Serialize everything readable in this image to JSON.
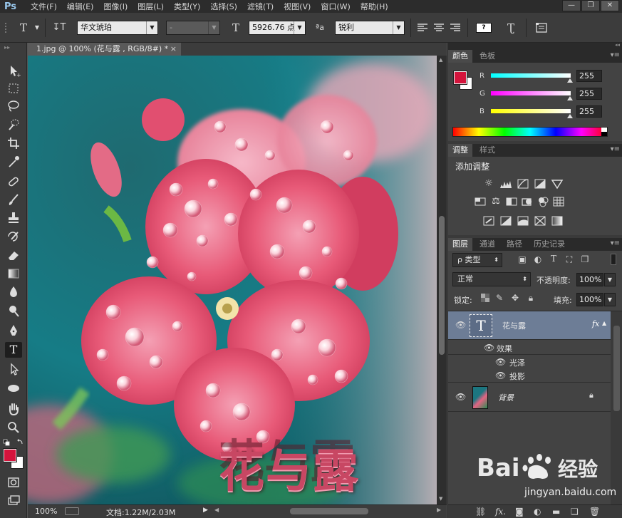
{
  "app": {
    "logo": "Ps",
    "menu": [
      "文件(F)",
      "编辑(E)",
      "图像(I)",
      "图层(L)",
      "类型(Y)",
      "选择(S)",
      "滤镜(T)",
      "视图(V)",
      "窗口(W)",
      "帮助(H)"
    ],
    "window_buttons": [
      "—",
      "❐",
      "✕"
    ]
  },
  "options_bar": {
    "font_family": "华文琥珀",
    "font_style": "-",
    "font_size": "5926.76 点",
    "aa_label": "ªa",
    "anti_alias": "锐利",
    "text_icon": "T",
    "orient_icon": "↧T",
    "size_icon": "T"
  },
  "document": {
    "tab_title": "1.jpg @ 100% (花与露 , RGB/8#) *",
    "close": "×",
    "overlay_text": "花与露"
  },
  "status": {
    "zoom": "100%",
    "doc_info": "文档:1.22M/2.03M"
  },
  "color_panel": {
    "tabs": [
      "颜色",
      "色板"
    ],
    "channels": [
      {
        "label": "R",
        "value": "255",
        "color": "#00ffff"
      },
      {
        "label": "G",
        "value": "255",
        "color": "#ff00ff"
      },
      {
        "label": "B",
        "value": "255",
        "color": "#ffff00"
      }
    ],
    "foreground": "#d4143c",
    "background": "#ffffff"
  },
  "adjust_panel": {
    "tabs": [
      "调整",
      "样式"
    ],
    "title": "添加调整"
  },
  "layers_panel": {
    "tabs": [
      "图层",
      "通道",
      "路径",
      "历史记录"
    ],
    "filter_kind": "ρ 类型",
    "blend_mode": "正常",
    "opacity_label": "不透明度:",
    "opacity": "100%",
    "lock_label": "锁定:",
    "fill_label": "填充:",
    "fill": "100%",
    "layers": [
      {
        "name": "花与露",
        "type": "text",
        "thumb": "T",
        "fx": "fx"
      },
      {
        "name": "背景",
        "type": "image"
      }
    ],
    "effects_label": "效果",
    "effects": [
      "光泽",
      "投影"
    ]
  },
  "watermark": {
    "logo": "Bai 经验",
    "url": "jingyan.baidu.com"
  }
}
